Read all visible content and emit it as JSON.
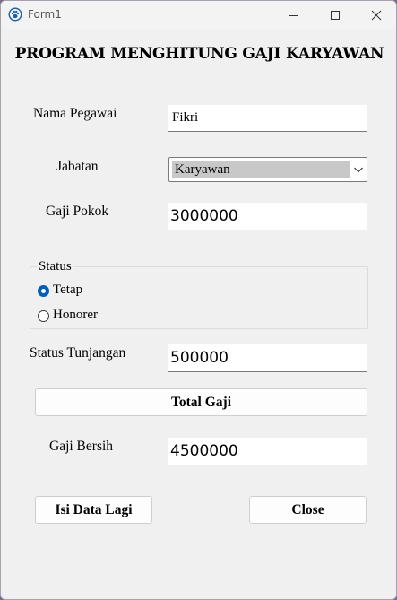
{
  "window": {
    "title": "Form1"
  },
  "heading": "PROGRAM MENGHITUNG GAJI KARYAWAN",
  "form": {
    "nama_label": "Nama Pegawai",
    "nama_value": "Fikri",
    "jabatan_label": "Jabatan",
    "jabatan_selected": "Karyawan",
    "gaji_pokok_label": "Gaji Pokok",
    "gaji_pokok_value": "3000000",
    "status_group_label": "Status",
    "status_options": [
      {
        "label": "Tetap",
        "checked": true
      },
      {
        "label": "Honorer",
        "checked": false
      }
    ],
    "tunjangan_label": "Status Tunjangan",
    "tunjangan_value": "500000",
    "total_button": "Total Gaji",
    "gaji_bersih_label": "Gaji Bersih",
    "gaji_bersih_value": "4500000",
    "isi_lagi_button": "Isi Data Lagi",
    "close_button": "Close"
  },
  "colors": {
    "radio_accent": "#005fb8",
    "window_bg": "#f0f0f0",
    "desktop_bg": "#7a6a86"
  },
  "icons": [
    "paw-app-icon",
    "minimize-icon",
    "maximize-icon",
    "close-icon",
    "chevron-down-icon"
  ]
}
